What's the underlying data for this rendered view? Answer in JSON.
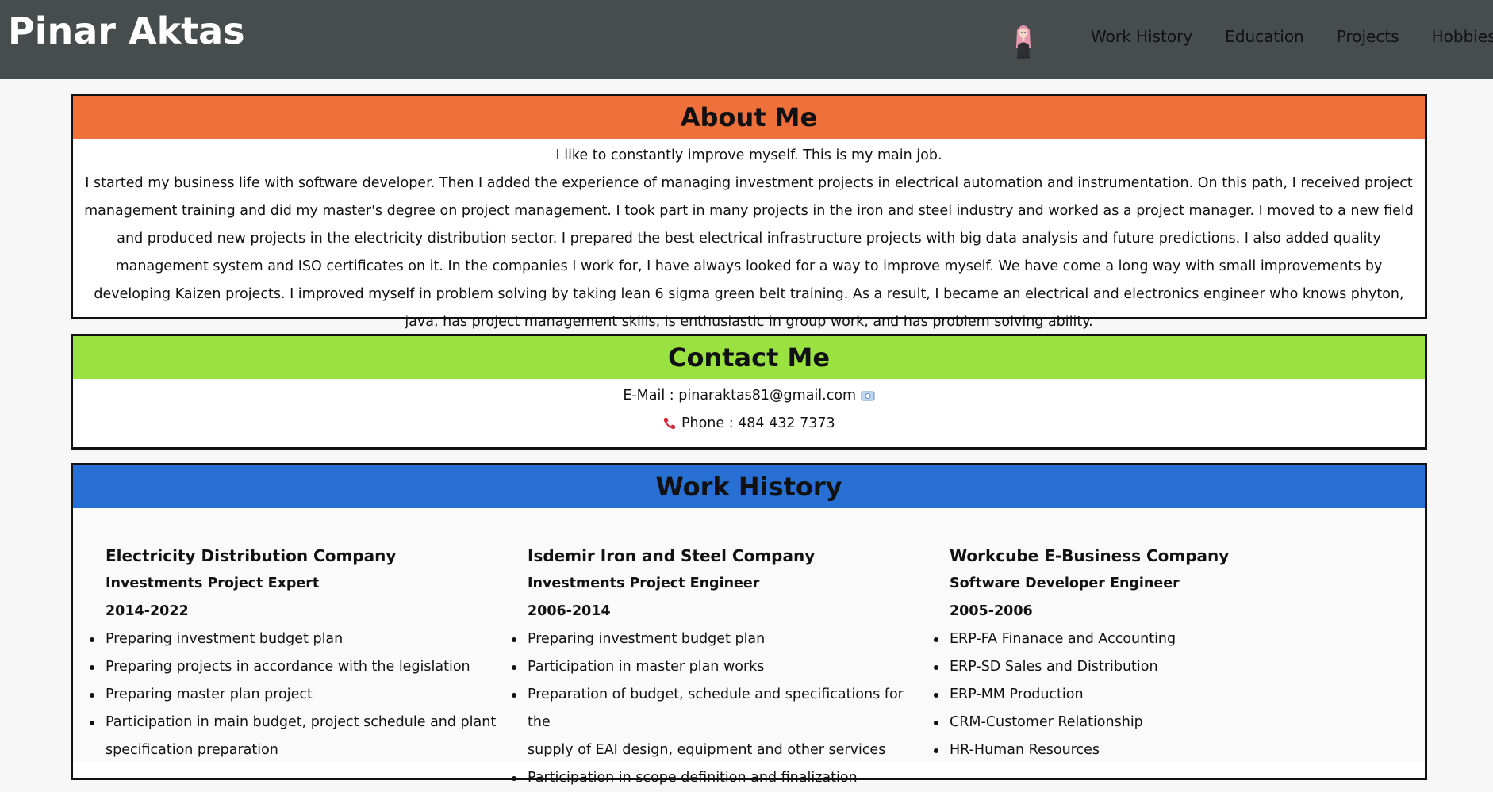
{
  "header": {
    "title": "Pinar Aktas",
    "nav": [
      "Work History",
      "Education",
      "Projects",
      "Hobbies"
    ]
  },
  "about": {
    "heading": "About Me",
    "lead": "I like to constantly improve myself. This is my main job.",
    "lines": [
      "I started my business life with software developer. Then I added the experience of managing investment projects in electrical automation and instrumentation. On this path, I received project management",
      "training and did my master's degree on project management. I took part in many projects in the iron and steel industry and worked as a project manager. I moved to a new field and produced new projects in",
      "the electricity distribution sector. I prepared the best electrical infrastructure projects with big data analysis and future predictions. I also added quality management system and ISO certificates on it. In the",
      "companies I work for, I have always looked for a way to improve myself. We have come a long way with small improvements by developing Kaizen projects. I improved myself in problem solving by taking lean",
      "6 sigma green belt training. As a result, I became an electrical and electronics engineer who knows phyton, java, has project management skills, is enthusiastic in group work, and has problem solving ability."
    ]
  },
  "contact": {
    "heading": "Contact Me",
    "email_text": "E-Mail : pinaraktas81@gmail.com",
    "phone_text": "Phone : 484 432 7373"
  },
  "work": {
    "heading": "Work History",
    "jobs": [
      {
        "company": "Electricity Distribution Company",
        "title": "Investments Project Expert",
        "years": "2014-2022",
        "tasks": [
          "Preparing investment budget plan",
          "Preparing projects in accordance with the legislation",
          "Preparing master plan project",
          "Participation in main budget, project schedule and plant",
          "specification preparation"
        ]
      },
      {
        "company": "Isdemir Iron and Steel Company",
        "title": "Investments Project Engineer",
        "years": "2006-2014",
        "tasks": [
          "Preparing investment budget plan",
          "Participation in master plan works",
          "Preparation of budget, schedule and specifications for the",
          "supply of EAI design, equipment and other services",
          "Participation in scope definition and finalization"
        ]
      },
      {
        "company": "Workcube E-Business Company",
        "title": "Software Developer Engineer",
        "years": "2005-2006",
        "tasks": [
          "ERP-FA Finanace and Accounting",
          "ERP-SD Sales and Distribution",
          "ERP-MM Production",
          "CRM-Customer Relationship",
          "HR-Human Resources"
        ]
      }
    ]
  }
}
